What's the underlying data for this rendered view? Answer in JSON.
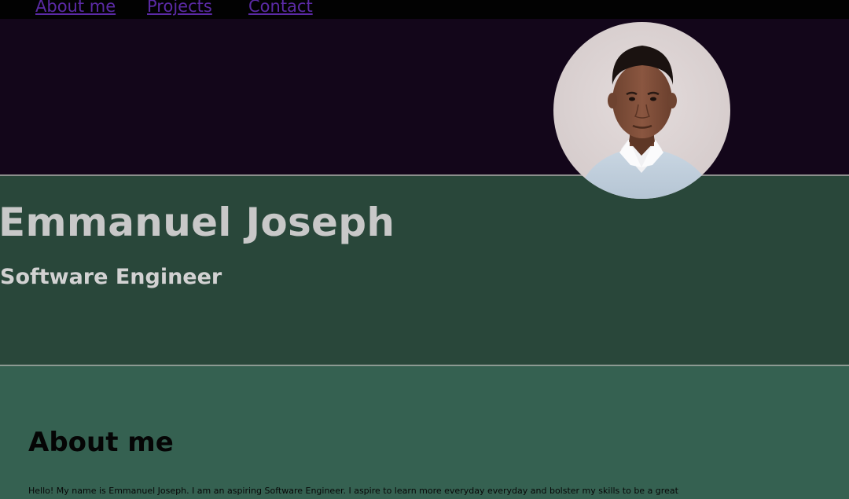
{
  "nav": {
    "links": [
      {
        "label": "About me"
      },
      {
        "label": "Projects"
      },
      {
        "label": "Contact"
      }
    ]
  },
  "hero": {
    "name": "Emmanuel Joseph",
    "role": "Software Engineer"
  },
  "about": {
    "title": "About me",
    "text": "Hello! My name is Emmanuel Joseph. I am an aspiring Software Engineer. I aspire to learn more everyday everyday and bolster my skills to be a great"
  },
  "colors": {
    "nav_bg": "#020202",
    "link": "#5b2aa5",
    "hero_top_bg": "#13061a",
    "hero_bottom_bg": "#29473a",
    "about_bg": "#356151"
  }
}
